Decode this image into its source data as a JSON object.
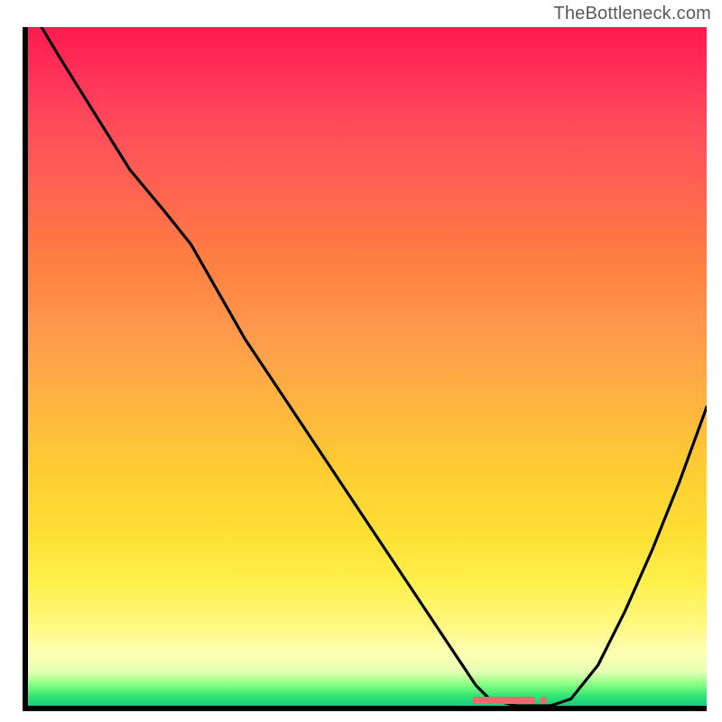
{
  "watermark": "TheBottleneck.com",
  "chart_data": {
    "type": "line",
    "title": "",
    "xlabel": "",
    "ylabel": "",
    "xlim": [
      0,
      100
    ],
    "ylim": [
      0,
      100
    ],
    "grid": false,
    "series": [
      {
        "name": "curve",
        "x": [
          2,
          5,
          10,
          15,
          20,
          24,
          28,
          32,
          38,
          44,
          50,
          56,
          60,
          64,
          66,
          68,
          72,
          77,
          80,
          84,
          88,
          92,
          96,
          100
        ],
        "y": [
          100,
          95,
          87,
          79,
          73,
          68,
          61,
          54,
          45,
          36,
          27,
          18,
          12,
          6,
          3,
          1,
          0,
          0,
          1,
          6,
          14,
          23,
          33,
          44
        ]
      }
    ],
    "marker": {
      "x_start": 65.5,
      "x_end": 76,
      "y": 0.8,
      "color": "#e86c6c",
      "shape": "hbar-with-dot"
    },
    "background_gradient": {
      "top": "#ff1a4d",
      "mid": "#ffe033",
      "bottom": "#1acc80"
    }
  }
}
